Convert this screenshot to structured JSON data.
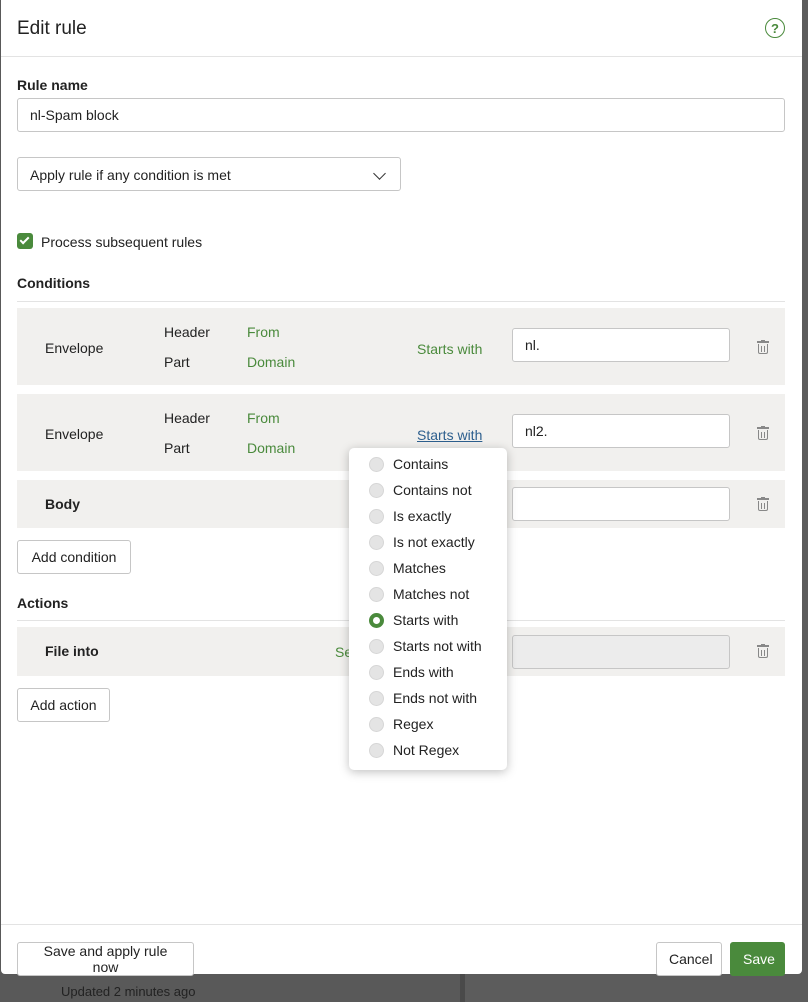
{
  "modal": {
    "title": "Edit rule",
    "help_icon": "question-circle-icon"
  },
  "rule_name": {
    "label": "Rule name",
    "value": "nl-Spam block"
  },
  "match_mode": {
    "selected": "Apply rule if any condition is met"
  },
  "process_subsequent": {
    "checked": true,
    "label": "Process subsequent rules"
  },
  "conditions": {
    "heading": "Conditions",
    "rows": [
      {
        "field": "Envelope",
        "sub1_label": "Header",
        "sub1_value": "From",
        "sub2_label": "Part",
        "sub2_value": "Domain",
        "operator": "Starts with",
        "value": "nl."
      },
      {
        "field": "Envelope",
        "sub1_label": "Header",
        "sub1_value": "From",
        "sub2_label": "Part",
        "sub2_value": "Domain",
        "operator": "Starts with",
        "value": "nl2."
      },
      {
        "field": "Body",
        "value": ""
      }
    ],
    "add_button": "Add condition"
  },
  "actions": {
    "heading": "Actions",
    "rows": [
      {
        "action": "File into",
        "partial_text": "Se"
      }
    ],
    "add_button": "Add action"
  },
  "operator_menu": {
    "selected": "Starts with",
    "options": [
      "Contains",
      "Contains not",
      "Is exactly",
      "Is not exactly",
      "Matches",
      "Matches not",
      "Starts with",
      "Starts not with",
      "Ends with",
      "Ends not with",
      "Regex",
      "Not Regex"
    ]
  },
  "footer": {
    "save_apply": "Save and apply rule now",
    "cancel": "Cancel",
    "save": "Save"
  },
  "background": {
    "footer_text": "Updated 2 minutes ago"
  },
  "colors": {
    "accent": "#4a8a3c",
    "link": "#2d5f8e",
    "row_bg": "#f1f0ee"
  }
}
